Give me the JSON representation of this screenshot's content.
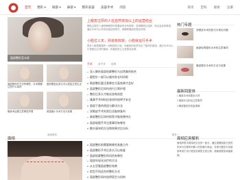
{
  "nav": {
    "items": [
      "首页",
      "整形 ▾",
      "眼部 ▾",
      "鼻部 ▾",
      "整形美容",
      "美容手术",
      "问答"
    ],
    "right": [
      "资讯",
      "百科",
      "搜索",
      "注册"
    ]
  },
  "hero": {
    "caption": "面部整形怎么样",
    "lead_title": "上眼皮过厚的人在自然增加以上的运营结合",
    "lead_text": "眼睑过厚的人通常睁眼的时候看起来没有精神，显得眼睛比较肿，而且会影响美观。通过手术可以有效改善这种情况，使眼睛看起来更加有神。",
    "lead2_title": "小脸拉三天，别说有收获，小脸就运行手术",
    "lead2_text": "很多人都想要拥有一张精致的小脸，而面部的轮廓决定了整体的美感，通过手术可以打造更加立体的面部，改善脸型让五官更加协调。"
  },
  "thumbs": [
    {
      "caption": "面部整形的方式有哪些，手术需要注意什么事项"
    },
    {
      "caption": "做双眼皮后多久可以恢复正常生活"
    },
    {
      "caption": "隆鼻术后要注意哪些护理"
    },
    {
      "caption": "鼻翼缩小手术方法与效果"
    }
  ],
  "tabs": [
    "手术",
    "非手术",
    "保养"
  ],
  "news": [
    "深入解析面部轮廓整形与自然美的结合",
    "瘦脸针一般可以维持多长时间呢",
    "眼部整形要注意哪些方面效果才会好",
    "面部整形后如何进行日常护理",
    "整形后多久才能化妆和洗脸",
    "隆鼻手术材料应该如何选择才安全",
    "眉部下垂的原因与解决方法",
    "双眼皮手术失败后还能修复吗",
    "鼻部整形后如何保养才能效果持久",
    "面部吸脂手术注意事项有哪些",
    "额头填充的方法和效果对比分析"
  ],
  "sec2": {
    "title": "面相",
    "sub": "面部整形",
    "more": "更多 >",
    "items": [
      "面部整形前需要做哪些准备工作",
      "面部整形手术后多久可以恢复",
      "面部轮廓整形的风险有哪些",
      "面部年轻化治疗的方法",
      "从五官看面部整形效果",
      "脸型不同适合的整形方式",
      "面部整形如何选择医生与机构"
    ]
  },
  "side": {
    "hot_title": "热门专题",
    "hot_items": [
      {
        "icon": "eye",
        "text": "双眼皮手术的技巧与常见问题"
      },
      {
        "icon": "face",
        "text": "面部轮廓整形手术的注意事项"
      },
      {
        "icon": "lip",
        "text": "唇部整形手术的方法与效果"
      }
    ],
    "latest_title": "最新回复体",
    "latest": [
      {
        "n": "1",
        "text": "隆鼻手术效果怎么样"
      },
      {
        "n": "2",
        "text": "瘦脸针注射后注意事项"
      },
      {
        "n": "3",
        "text": "眼部整形的恢复周期"
      }
    ],
    "apply_title": "面相应用解析",
    "apply_text": "面相学是中国传统文化的一部分，通过观察面部五官的形状与位置来判断人的性格与命运，在现代整形中也被参考用于设计更加协调的五官比例，使面部更加和谐美观。"
  }
}
